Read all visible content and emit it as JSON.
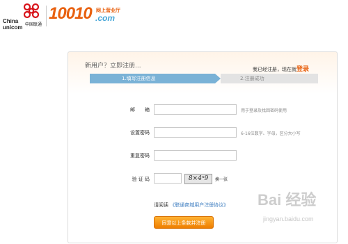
{
  "header": {
    "logo_en_line1": "China",
    "logo_en_line2": "unicom",
    "logo_cn": "中国联通",
    "service_number": "10010",
    "online_hall": "网上营业厅",
    "domain_suffix": ".com"
  },
  "panel": {
    "title": "新用户？立即注册...",
    "already_registered": "我已经注册，现在就",
    "login_link": "登录",
    "steps": [
      {
        "label": "1.填写注册信息"
      },
      {
        "label": "2.注册成功"
      }
    ]
  },
  "form": {
    "email_label": "邮　　箱",
    "email_hint": "用于登录及找回密码使用",
    "password_label": "设置密码",
    "password_hint": "6-16位数字、字母，区分大小写",
    "confirm_label": "重复密码",
    "captcha_label": "验 证 码",
    "captcha_text": "8×4ⁿ9",
    "refresh_label": "换一张",
    "agree_prefix": "请阅读",
    "agreement_link": "《联通商城用户注册协议》",
    "submit_label": "同意以上条款并注册"
  },
  "watermark": {
    "main": "Bai 经验",
    "sub": "jingyan.baidu.com"
  },
  "colors": {
    "brand_orange": "#e8600f",
    "step_active": "#7ab2d6",
    "link_blue": "#3a7bbf"
  }
}
